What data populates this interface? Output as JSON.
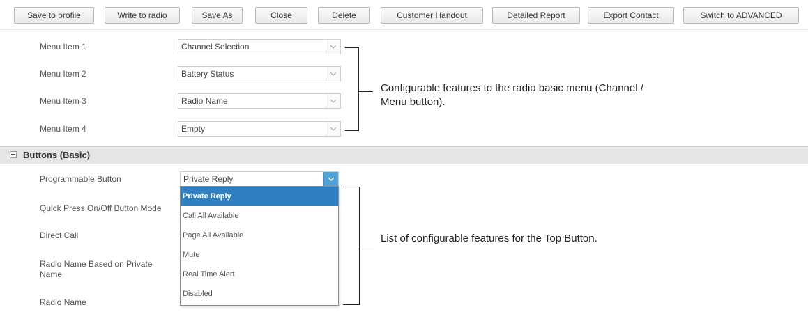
{
  "toolbar": {
    "buttons": [
      "Save to profile",
      "Write to radio",
      "Save As",
      "Close",
      "Delete",
      "Customer Handout",
      "Detailed Report",
      "Export Contact",
      "Switch to ADVANCED"
    ]
  },
  "menu_items": [
    {
      "label": "Menu Item 1",
      "value": "Channel Selection"
    },
    {
      "label": "Menu Item 2",
      "value": "Battery Status"
    },
    {
      "label": "Menu Item 3",
      "value": "Radio Name"
    },
    {
      "label": "Menu Item 4",
      "value": "Empty"
    }
  ],
  "buttons_section": {
    "title": "Buttons (Basic)",
    "rows": [
      {
        "label": "Programmable Button",
        "value": "Private Reply"
      },
      {
        "label": "Quick Press On/Off Button Mode"
      },
      {
        "label": "Direct Call"
      },
      {
        "label": "Radio Name Based on Private Name"
      },
      {
        "label": "Radio Name"
      }
    ]
  },
  "dropdown": {
    "selected": "Private Reply",
    "options": [
      "Private Reply",
      "Call All Available",
      "Page All Available",
      "Mute",
      "Real Time Alert",
      "Disabled"
    ]
  },
  "annotations": {
    "menu": "Configurable features to the radio basic menu (Channel / Menu button).",
    "button": "List of configurable features for the Top Button."
  },
  "colors": {
    "selected_item_bg": "#2f7fc1",
    "section_bar_bg": "#e6e6e6",
    "dropdown_arrow_active": "#4fa3d8"
  }
}
